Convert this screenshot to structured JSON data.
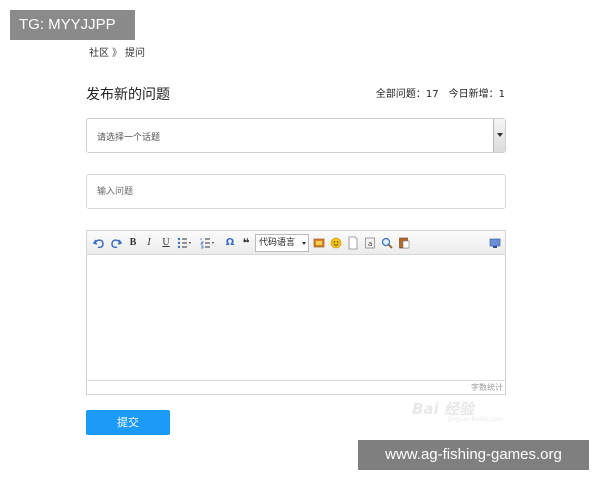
{
  "overlay": {
    "tg_label": "TG: MYYJJPP",
    "site_label": "www.ag-fishing-games.org"
  },
  "breadcrumb": {
    "community": "社区",
    "separator": "》",
    "ask": "提问"
  },
  "header": {
    "title": "发布新的问题",
    "total_label": "全部问题：",
    "total_value": "17",
    "today_label": "今日新增：",
    "today_value": "1"
  },
  "topic_select": {
    "placeholder": "请选择一个话题"
  },
  "question_input": {
    "placeholder": "输入问题"
  },
  "editor": {
    "toolbar": {
      "undo_icon": "undo-icon",
      "redo_icon": "redo-icon",
      "bold": "B",
      "italic": "I",
      "underline": "U",
      "special_char": "Ω",
      "quote": "❝",
      "code_language": "代码语言"
    },
    "word_count_label": "字数统计"
  },
  "submit": {
    "label": "提交"
  },
  "watermark": {
    "main": "Bai 经验",
    "sub": "jingyan.baidu.com"
  },
  "colors": {
    "primary_button": "#1b9af7",
    "badge_bg": "#808080"
  }
}
